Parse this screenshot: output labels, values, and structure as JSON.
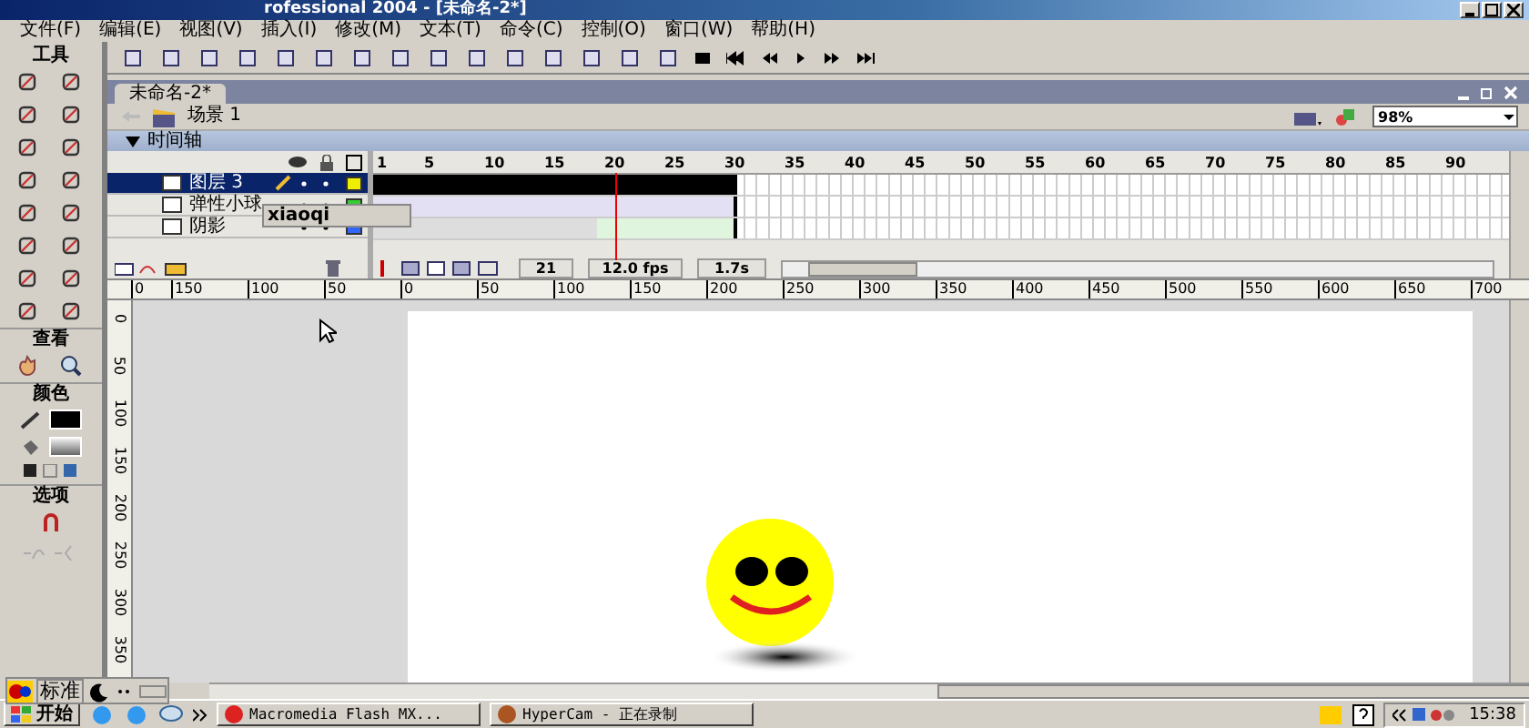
{
  "window": {
    "title": "rofessional 2004 - [未命名-2*]"
  },
  "menu": [
    "文件(F)",
    "编辑(E)",
    "视图(V)",
    "插入(I)",
    "修改(M)",
    "文本(T)",
    "命令(C)",
    "控制(O)",
    "窗口(W)",
    "帮助(H)"
  ],
  "tools_panel": {
    "title": "工具",
    "sections": [
      "查看",
      "颜色",
      "选项"
    ]
  },
  "document": {
    "tab": "未命名-2*",
    "scene": "场景 1",
    "zoom": "98%"
  },
  "timeline": {
    "title": "时间轴",
    "frame_numbers": [
      "1",
      "5",
      "10",
      "15",
      "20",
      "25",
      "30",
      "35",
      "40",
      "45",
      "50",
      "55",
      "60",
      "65",
      "70",
      "75",
      "80",
      "85",
      "90"
    ],
    "layers": [
      {
        "name": "图层 3",
        "selected": true
      },
      {
        "name": "弹性小球",
        "selected": false
      },
      {
        "name": "阴影",
        "selected": false
      }
    ],
    "tooltip": "xiaoqi",
    "current_frame": "21",
    "frame_rate": "12.0 fps",
    "elapsed": "1.7s"
  },
  "rulers": {
    "horizontal": [
      "0",
      "150",
      "100",
      "50",
      "0",
      "50",
      "100",
      "150",
      "200",
      "250",
      "300",
      "350",
      "400",
      "450",
      "500",
      "550",
      "600",
      "650",
      "700"
    ],
    "vertical": [
      "0",
      "50",
      "100",
      "150",
      "200",
      "250",
      "300",
      "350"
    ]
  },
  "ime": {
    "label": "标准"
  },
  "taskbar": {
    "start": "开始",
    "tasks": [
      "Macromedia Flash MX...",
      "HyperCam - 正在录制"
    ],
    "clock": "15:38"
  }
}
